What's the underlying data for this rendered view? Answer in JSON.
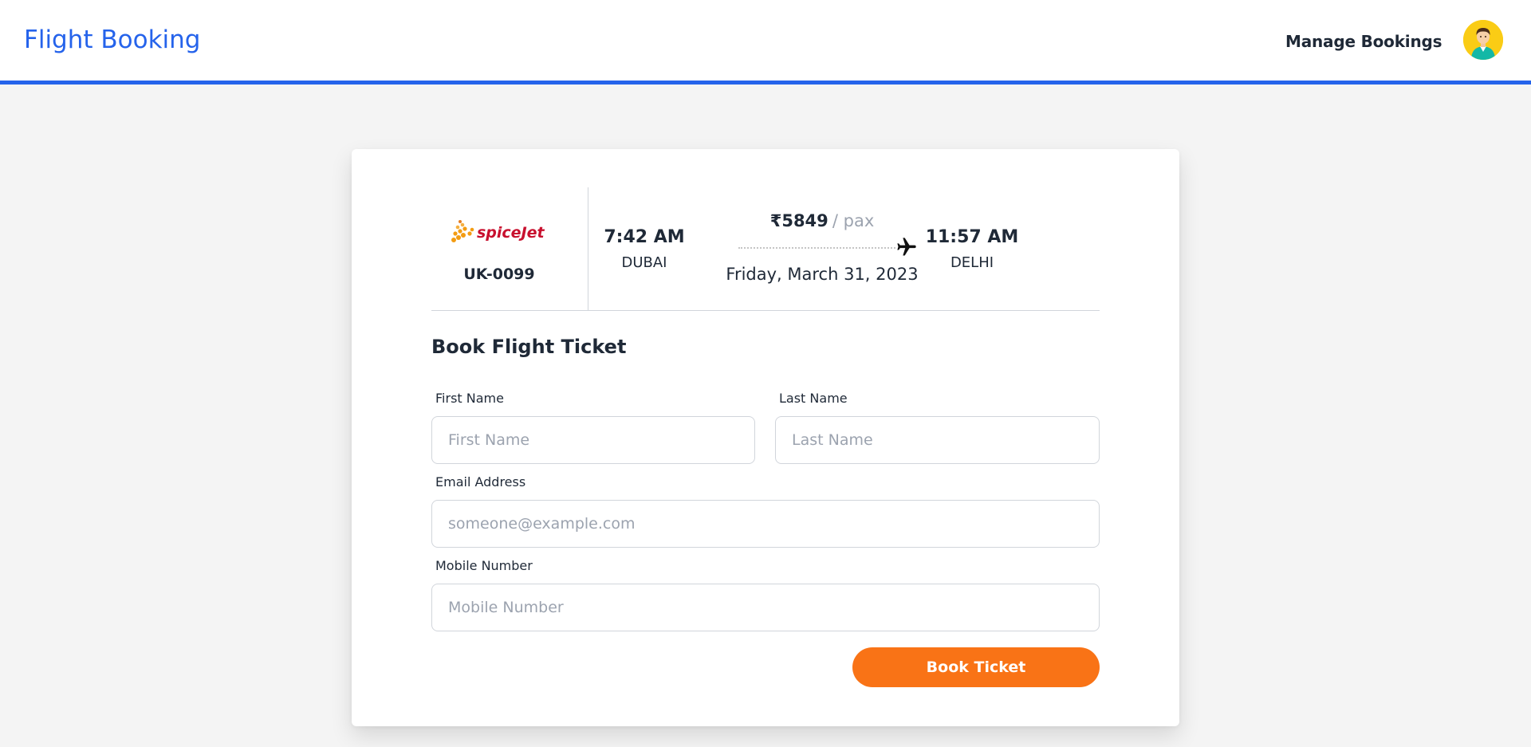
{
  "header": {
    "brand": "Flight Booking",
    "manage_bookings": "Manage Bookings"
  },
  "flight": {
    "airline_logo_text": "spiceJet",
    "flight_number": "UK-0099",
    "departure_time": "7:42 AM",
    "departure_city": "DUBAI",
    "price": "₹5849",
    "price_unit": "/ pax",
    "date": "Friday, March 31, 2023",
    "arrival_time": "11:57 AM",
    "arrival_city": "DELHI"
  },
  "form": {
    "title": "Book Flight Ticket",
    "first_name": {
      "label": "First Name",
      "placeholder": "First Name",
      "value": ""
    },
    "last_name": {
      "label": "Last Name",
      "placeholder": "Last Name",
      "value": ""
    },
    "email": {
      "label": "Email Address",
      "placeholder": "someone@example.com",
      "value": ""
    },
    "mobile": {
      "label": "Mobile Number",
      "placeholder": "Mobile Number",
      "value": ""
    },
    "submit_label": "Book Ticket"
  },
  "colors": {
    "brand_blue": "#2563eb",
    "button_orange": "#f97316",
    "avatar_yellow": "#facc15",
    "airline_red": "#c8102e"
  },
  "icons": {
    "avatar": "user-avatar-icon",
    "plane": "airplane-icon",
    "airline": "spicejet-logo"
  }
}
